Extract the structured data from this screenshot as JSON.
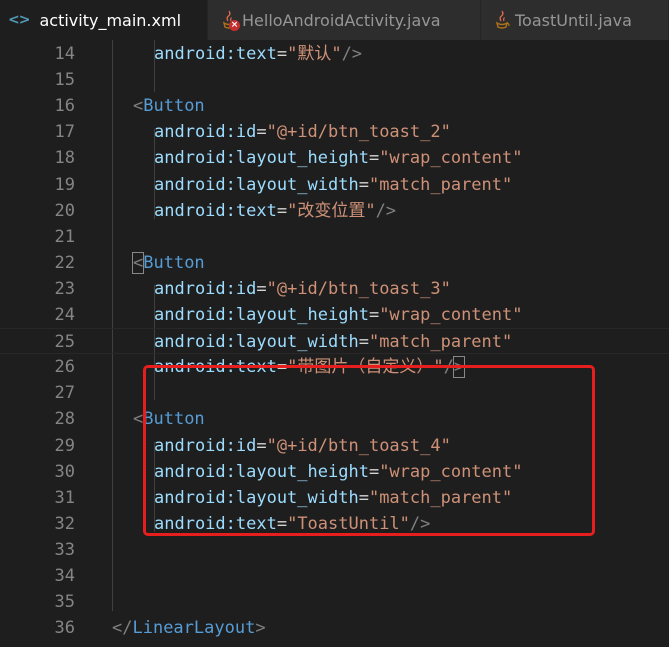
{
  "tabs": [
    {
      "label": "activity_main.xml",
      "icon": "xml-code-icon",
      "active": true
    },
    {
      "label": "HelloAndroidActivity.java",
      "icon": "java-icon",
      "error": true,
      "active": false
    },
    {
      "label": "ToastUntil.java",
      "icon": "java-icon",
      "active": false
    }
  ],
  "colors": {
    "background": "#1e1e1e",
    "tag": "#569cd6",
    "attribute": "#9cdcfe",
    "string": "#ce9178",
    "bracket": "#808080",
    "line_number": "#858585",
    "highlight_box": "#e61e1e"
  },
  "lines": [
    {
      "n": "14",
      "indent": 4,
      "tokens": [
        [
          "attr",
          "android:text"
        ],
        [
          "eq",
          "="
        ],
        [
          "str",
          "\"默认\""
        ],
        [
          "brk",
          "/>"
        ]
      ]
    },
    {
      "n": "15",
      "indent": 0,
      "tokens": []
    },
    {
      "n": "16",
      "indent": 2,
      "tokens": [
        [
          "brk",
          "<"
        ],
        [
          "tag",
          "Button"
        ]
      ]
    },
    {
      "n": "17",
      "indent": 4,
      "tokens": [
        [
          "attr",
          "android:id"
        ],
        [
          "eq",
          "="
        ],
        [
          "str",
          "\"@+id/btn_toast_2\""
        ]
      ]
    },
    {
      "n": "18",
      "indent": 4,
      "tokens": [
        [
          "attr",
          "android:layout_height"
        ],
        [
          "eq",
          "="
        ],
        [
          "str",
          "\"wrap_content\""
        ]
      ]
    },
    {
      "n": "19",
      "indent": 4,
      "tokens": [
        [
          "attr",
          "android:layout_width"
        ],
        [
          "eq",
          "="
        ],
        [
          "str",
          "\"match_parent\""
        ]
      ]
    },
    {
      "n": "20",
      "indent": 4,
      "tokens": [
        [
          "attr",
          "android:text"
        ],
        [
          "eq",
          "="
        ],
        [
          "str",
          "\"改变位置\""
        ],
        [
          "brk",
          "/>"
        ]
      ]
    },
    {
      "n": "21",
      "indent": 0,
      "tokens": []
    },
    {
      "n": "22",
      "indent": 2,
      "tokens": [
        [
          "brk",
          "<",
          "box"
        ],
        [
          "tag",
          "Button"
        ]
      ]
    },
    {
      "n": "23",
      "indent": 4,
      "tokens": [
        [
          "attr",
          "android:id"
        ],
        [
          "eq",
          "="
        ],
        [
          "str",
          "\"@+id/btn_toast_3\""
        ]
      ]
    },
    {
      "n": "24",
      "indent": 4,
      "tokens": [
        [
          "attr",
          "android:layout_height"
        ],
        [
          "eq",
          "="
        ],
        [
          "str",
          "\"wrap_content\""
        ]
      ]
    },
    {
      "n": "25",
      "indent": 4,
      "current": true,
      "tokens": [
        [
          "attr",
          "android:layout_width"
        ],
        [
          "eq",
          "="
        ],
        [
          "str",
          "\"match_parent\""
        ]
      ]
    },
    {
      "n": "26",
      "indent": 4,
      "tokens": [
        [
          "attr",
          "android:text"
        ],
        [
          "eq",
          "="
        ],
        [
          "str",
          "\"带图片（自定义）\""
        ],
        [
          "brk",
          "/"
        ],
        [
          "brk",
          ">",
          "box"
        ]
      ]
    },
    {
      "n": "27",
      "indent": 0,
      "tokens": []
    },
    {
      "n": "28",
      "indent": 2,
      "tokens": [
        [
          "brk",
          "<"
        ],
        [
          "tag",
          "Button"
        ]
      ]
    },
    {
      "n": "29",
      "indent": 4,
      "tokens": [
        [
          "attr",
          "android:id"
        ],
        [
          "eq",
          "="
        ],
        [
          "str",
          "\"@+id/btn_toast_4\""
        ]
      ]
    },
    {
      "n": "30",
      "indent": 4,
      "tokens": [
        [
          "attr",
          "android:layout_height"
        ],
        [
          "eq",
          "="
        ],
        [
          "str",
          "\"wrap_content\""
        ]
      ]
    },
    {
      "n": "31",
      "indent": 4,
      "tokens": [
        [
          "attr",
          "android:layout_width"
        ],
        [
          "eq",
          "="
        ],
        [
          "str",
          "\"match_parent\""
        ]
      ]
    },
    {
      "n": "32",
      "indent": 4,
      "tokens": [
        [
          "attr",
          "android:text"
        ],
        [
          "eq",
          "="
        ],
        [
          "str",
          "\"ToastUntil\""
        ],
        [
          "brk",
          "/>"
        ]
      ]
    },
    {
      "n": "33",
      "indent": 0,
      "tokens": []
    },
    {
      "n": "34",
      "indent": 0,
      "tokens": []
    },
    {
      "n": "35",
      "indent": 0,
      "tokens": []
    },
    {
      "n": "36",
      "indent": 0,
      "tokens": [
        [
          "brk",
          "</"
        ],
        [
          "tag",
          "LinearLayout"
        ],
        [
          "brk",
          ">"
        ]
      ]
    }
  ]
}
